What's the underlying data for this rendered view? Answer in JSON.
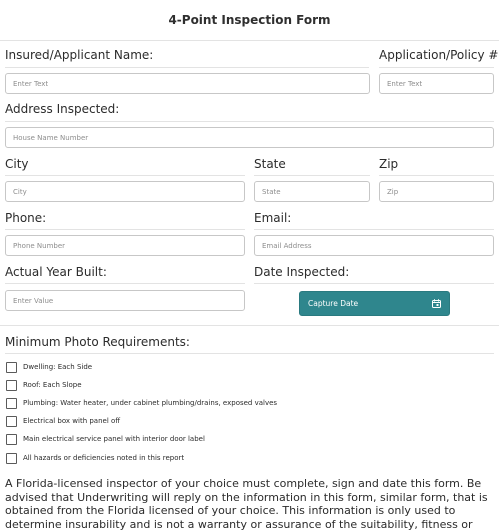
{
  "form": {
    "title": "4-Point Inspection Form"
  },
  "fields": {
    "insured_name": {
      "label": "Insured/Applicant Name:",
      "placeholder": "Enter Text"
    },
    "policy": {
      "label": "Application/Policy #:",
      "placeholder": "Enter Text"
    },
    "address": {
      "label": "Address Inspected:",
      "placeholder": "House Name Number"
    },
    "city": {
      "label": "City",
      "placeholder": "City"
    },
    "state": {
      "label": "State",
      "placeholder": "State"
    },
    "zip": {
      "label": "Zip",
      "placeholder": "Zip"
    },
    "phone": {
      "label": "Phone:",
      "placeholder": "Phone Number"
    },
    "email": {
      "label": "Email:",
      "placeholder": "Email Address"
    },
    "year_built": {
      "label": "Actual Year Built:",
      "placeholder": "Enter Value"
    },
    "date_inspected": {
      "label": "Date Inspected:",
      "button": "Capture Date",
      "icon": "calendar-icon",
      "color": "#2f868d"
    }
  },
  "photos": {
    "heading": "Minimum Photo Requirements:",
    "items": [
      "Dwelling: Each Side",
      "Roof: Each Slope",
      "Plumbing: Water heater, under cabinet plumbing/drains, exposed valves",
      "Electrical box with panel off",
      "Main electrical service panel with interior door label",
      "All hazards or deficiencies noted in this report"
    ]
  },
  "disclaimer": "A Florida-licensed inspector of your choice must complete, sign and date this form. Be advised that Underwriting will reply on the information in this form, similar form, that is obtained from the Florida licensed of your choice. This information is only used to determine insurability and is not a warranty or assurance of the suitability, fitness or"
}
